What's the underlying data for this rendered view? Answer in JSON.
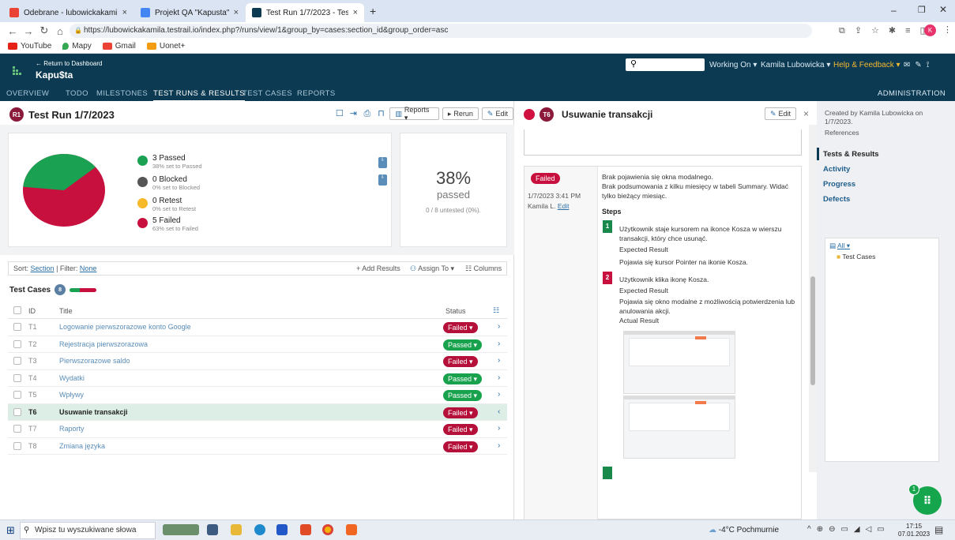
{
  "browser": {
    "tabs": [
      {
        "label": "Odebrane - lubowickakamila@gm"
      },
      {
        "label": "Projekt QA \"Kapusta\" - Dokumen"
      },
      {
        "label": "Test Run 1/7/2023 - TestRail"
      }
    ],
    "url": "https://lubowickakamila.testrail.io/index.php?/runs/view/1&group_by=cases:section_id&group_order=asc",
    "bookmarks": [
      "YouTube",
      "Mapy",
      "Gmail",
      "Uonet+"
    ],
    "profile_initial": "K"
  },
  "header": {
    "back": "← Return to Dashboard",
    "project": "Kapu$ta",
    "working_on": "Working On ▾",
    "user": "Kamila Lubowicka ▾",
    "help": "Help & Feedback ▾",
    "nav": [
      "OVERVIEW",
      "TODO",
      "MILESTONES",
      "TEST RUNS & RESULTS",
      "TEST CASES",
      "REPORTS"
    ],
    "admin": "ADMINISTRATION"
  },
  "run": {
    "badge": "R1",
    "title": "Test Run 1/7/2023",
    "reports": "Reports ▾",
    "rerun": "Rerun",
    "edit": "Edit"
  },
  "stats": {
    "passed": {
      "label": "3 Passed",
      "sub": "38% set to Passed"
    },
    "blocked": {
      "label": "0 Blocked",
      "sub": "0% set to Blocked"
    },
    "retest": {
      "label": "0 Retest",
      "sub": "0% set to Retest"
    },
    "failed": {
      "label": "5 Failed",
      "sub": "63% set to Failed"
    },
    "percent": "38%",
    "passed_word": "passed",
    "untested": "0 / 8 untested (0%).",
    "pass_fraction": 0.375
  },
  "toolbar": {
    "sort_label": "Sort:",
    "sort_value": "Section",
    "filter_label": "Filter:",
    "filter_value": "None",
    "add_results": "Add Results",
    "assign_to": "Assign To ▾",
    "columns": "Columns"
  },
  "cases": {
    "title": "Test Cases",
    "count": "8",
    "col_id": "ID",
    "col_title": "Title",
    "col_status": "Status",
    "rows": [
      {
        "id": "T1",
        "title": "Logowanie pierwszorazowe konto Google",
        "status": "Failed ▾"
      },
      {
        "id": "T2",
        "title": "Rejestracja pierwszorazowa",
        "status": "Passed ▾"
      },
      {
        "id": "T3",
        "title": "Pierwszorazowe saldo",
        "status": "Failed ▾"
      },
      {
        "id": "T4",
        "title": "Wydatki",
        "status": "Passed ▾"
      },
      {
        "id": "T5",
        "title": "Wpływy",
        "status": "Passed ▾"
      },
      {
        "id": "T6",
        "title": "Usuwanie transakcji",
        "status": "Failed ▾"
      },
      {
        "id": "T7",
        "title": "Raporty",
        "status": "Failed ▾"
      },
      {
        "id": "T8",
        "title": "Zmiana języka",
        "status": "Failed ▾"
      }
    ]
  },
  "detail": {
    "badge": "T6",
    "title": "Usuwanie transakcji",
    "edit": "Edit",
    "close": "×",
    "status": "Failed",
    "date": "1/7/2023 3:41 PM",
    "author": "Kamila L.",
    "author_edit": "Edit",
    "comment1": "Brak pojawienia się okna modalnego.",
    "comment2": "Brak podsumowania z kilku miesięcy w tabeli Summary. Widać tylko bieżący miesiąc.",
    "steps_label": "Steps",
    "steps": [
      {
        "num": "1",
        "text": "Użytkownik staje kursorem na ikonce Kosza w wierszu transakcji, który chce usunąć.",
        "expected_label": "Expected Result",
        "expected": "Pojawia się kursor Pointer na ikonie Kosza."
      },
      {
        "num": "2",
        "text": "Użytkownik klika ikonę Kosza.",
        "expected_label": "Expected Result",
        "expected": "Pojawia się okno modalne z możliwością potwierdzenia lub anulowania akcji.",
        "actual_label": "Actual Result"
      }
    ]
  },
  "sidebar": {
    "created": "Created by Kamila Lubowicka on 1/7/2023.",
    "references": "References",
    "links": [
      "Tests & Results",
      "Activity",
      "Progress",
      "Defects"
    ],
    "tree_all": "All ▾",
    "tree_node": "Test Cases"
  },
  "fab": {
    "badge": "1"
  },
  "taskbar": {
    "search_placeholder": "Wpisz tu wyszukiwane słowa",
    "weather": "-4°C  Pochmurnie",
    "time": "17:15",
    "date": "07.01.2023"
  },
  "colors": {
    "header_bg": "#0b3a52",
    "passed": "#18a24e",
    "failed": "#b5103a",
    "blocked": "#555555",
    "retest": "#f5b92a",
    "link": "#2a6ea6"
  }
}
